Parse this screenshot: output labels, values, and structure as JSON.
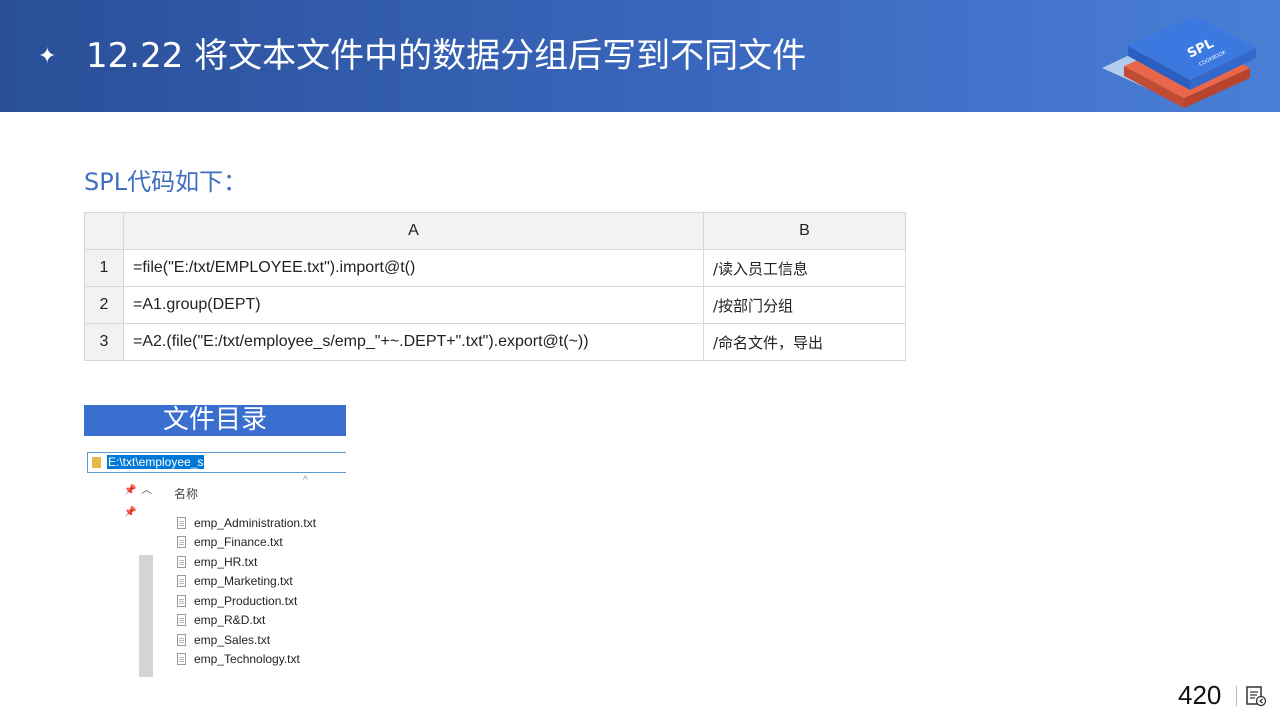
{
  "header": {
    "bullet": "✦",
    "title": "12.22 将文本文件中的数据分组后写到不同文件",
    "logo_text": "SPL",
    "logo_subtext": "COOKBOOK"
  },
  "section": {
    "subtitle": "SPL代码如下："
  },
  "code_table": {
    "columns": [
      "A",
      "B"
    ],
    "rows": [
      {
        "num": "1",
        "a": "=file(\"E:/txt/EMPLOYEE.txt\").import@t()",
        "b": "/读入员工信息"
      },
      {
        "num": "2",
        "a": "=A1.group(DEPT)",
        "b": "/按部门分组"
      },
      {
        "num": "3",
        "a": "=A2.(file(\"E:/txt/employee_s/emp_\"+~.DEPT+\".txt\").export@t(~))",
        "b": "/命名文件，导出"
      }
    ]
  },
  "directory": {
    "title": "文件目录",
    "address": "E:\\txt\\employee_s",
    "column_header": "名称",
    "files": [
      "emp_Administration.txt",
      "emp_Finance.txt",
      "emp_HR.txt",
      "emp_Marketing.txt",
      "emp_Production.txt",
      "emp_R&D.txt",
      "emp_Sales.txt",
      "emp_Technology.txt"
    ]
  },
  "footer": {
    "page_number": "420"
  },
  "colors": {
    "header": "#3a67bd",
    "accent": "#3f6fc0",
    "dir_title_bg": "#3a6fcf"
  }
}
